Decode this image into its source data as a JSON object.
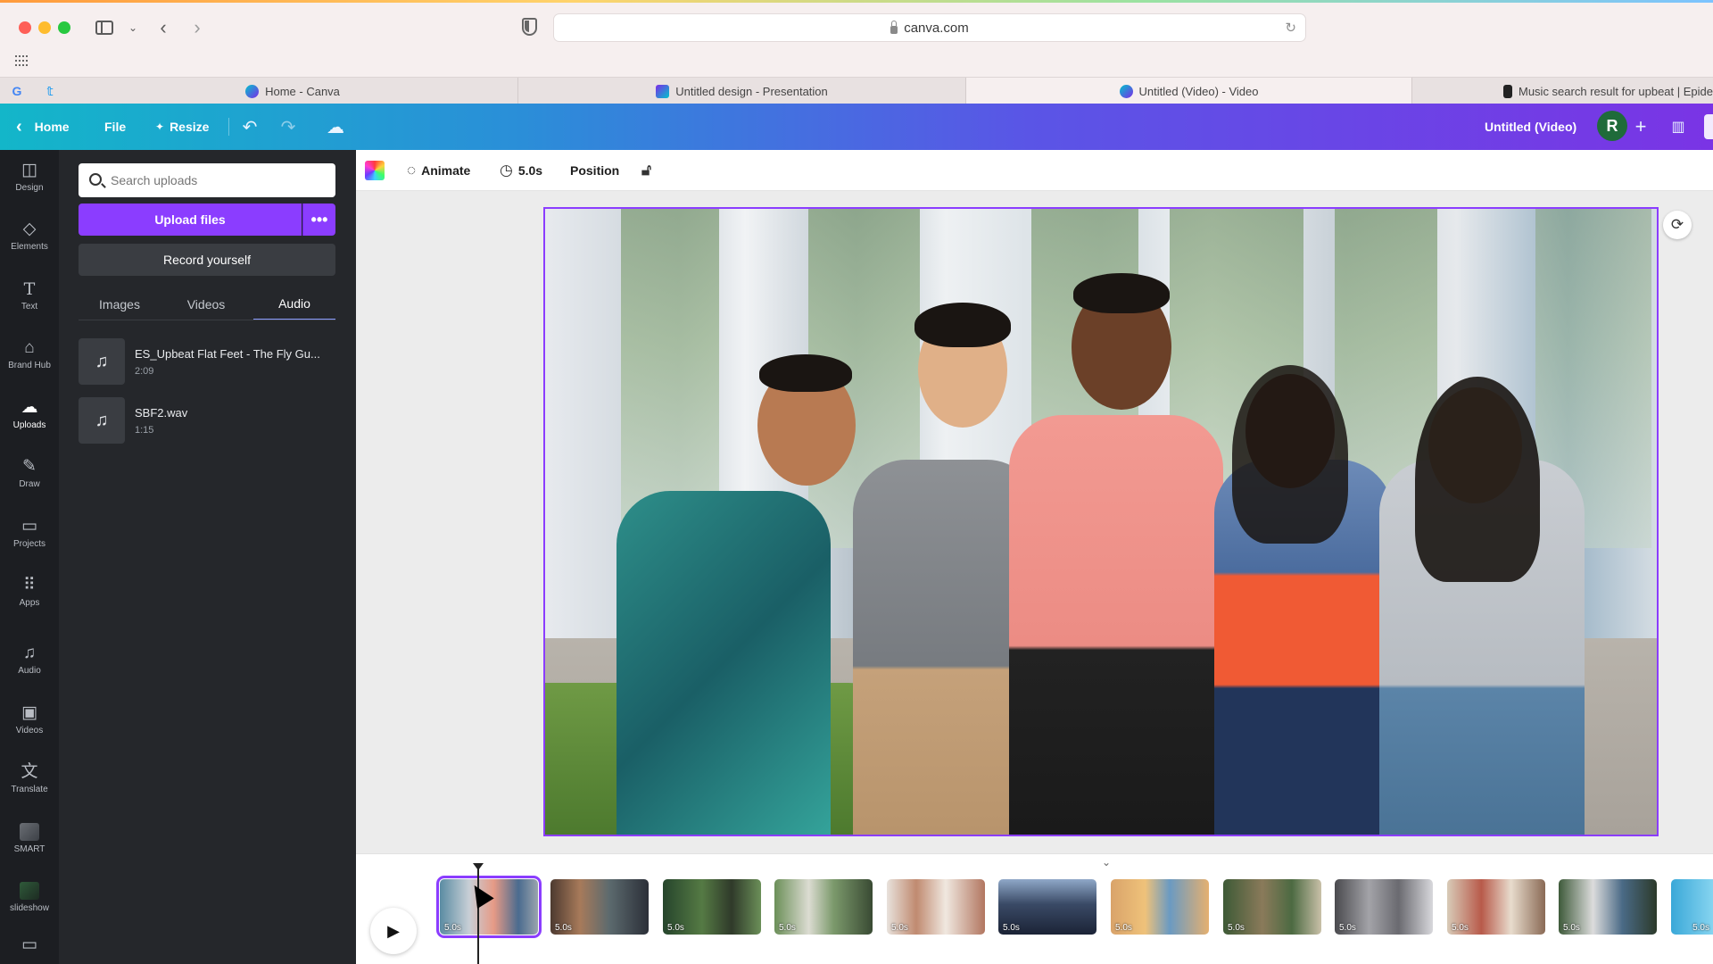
{
  "browser": {
    "address": "canva.com",
    "tabs": [
      {
        "label": "Home - Canva",
        "active": false
      },
      {
        "label": "Untitled design - Presentation",
        "active": false
      },
      {
        "label": "Untitled (Video) - Video",
        "active": true
      },
      {
        "label": "Music search result for upbeat | Epide",
        "active": false
      }
    ],
    "pinned": [
      "google-icon",
      "twitter-icon"
    ]
  },
  "header": {
    "home_label": "Home",
    "file_label": "File",
    "resize_label": "Resize",
    "doc_title": "Untitled (Video)",
    "avatar_letter": "R",
    "gradient_start": "#13b6c9",
    "gradient_end": "#7a34e5"
  },
  "rail": {
    "items": [
      {
        "label": "Design",
        "icon": "layout-icon"
      },
      {
        "label": "Elements",
        "icon": "shapes-icon"
      },
      {
        "label": "Text",
        "icon": "text-icon"
      },
      {
        "label": "Brand Hub",
        "icon": "brand-icon"
      },
      {
        "label": "Uploads",
        "icon": "cloud-upload-icon",
        "active": true
      },
      {
        "label": "Draw",
        "icon": "pen-icon"
      },
      {
        "label": "Projects",
        "icon": "folder-icon"
      },
      {
        "label": "Apps",
        "icon": "apps-icon"
      },
      {
        "label": "Audio",
        "icon": "music-icon"
      },
      {
        "label": "Videos",
        "icon": "video-icon"
      },
      {
        "label": "Translate",
        "icon": "translate-icon"
      },
      {
        "label": "SMART",
        "icon": "smart-icon"
      },
      {
        "label": "slideshow",
        "icon": "slideshow-icon"
      }
    ]
  },
  "panel": {
    "search_placeholder": "Search uploads",
    "upload_label": "Upload files",
    "more_label": "•••",
    "record_label": "Record yourself",
    "tabs": [
      {
        "label": "Images",
        "active": false
      },
      {
        "label": "Videos",
        "active": false
      },
      {
        "label": "Audio",
        "active": true
      }
    ],
    "audio": [
      {
        "title": "ES_Upbeat Flat Feet - The Fly Gu...",
        "duration": "2:09"
      },
      {
        "title": "SBF2.wav",
        "duration": "1:15"
      }
    ],
    "accent": "#8b3dff"
  },
  "toolbar": {
    "animate_label": "Animate",
    "duration_label": "5.0s",
    "position_label": "Position"
  },
  "timeline": {
    "scenes": [
      {
        "duration": "5.0s",
        "active": true
      },
      {
        "duration": "5.0s"
      },
      {
        "duration": "5.0s"
      },
      {
        "duration": "5.0s"
      },
      {
        "duration": "5.0s"
      },
      {
        "duration": "5.0s"
      },
      {
        "duration": "5.0s"
      },
      {
        "duration": "5.0s"
      },
      {
        "duration": "5.0s"
      },
      {
        "duration": "5.0s"
      },
      {
        "duration": "5.0s"
      },
      {
        "duration": "5.0s"
      }
    ]
  }
}
